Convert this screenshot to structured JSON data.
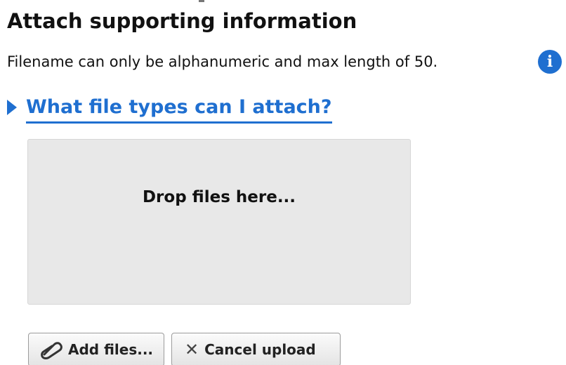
{
  "section": {
    "title": "Attach supporting information",
    "hint": "Filename can only be alphanumeric and max length of 50.",
    "info_icon": "info-icon"
  },
  "details": {
    "label": "What file types can I attach?",
    "icon": "triangle-right-icon",
    "accent_color": "#1f6fd0"
  },
  "dropzone": {
    "label": "Drop files here..."
  },
  "actions": {
    "add_files_label": "Add files...",
    "add_files_icon": "paperclip-icon",
    "cancel_upload_label": "Cancel upload",
    "cancel_upload_icon": "close-icon"
  }
}
